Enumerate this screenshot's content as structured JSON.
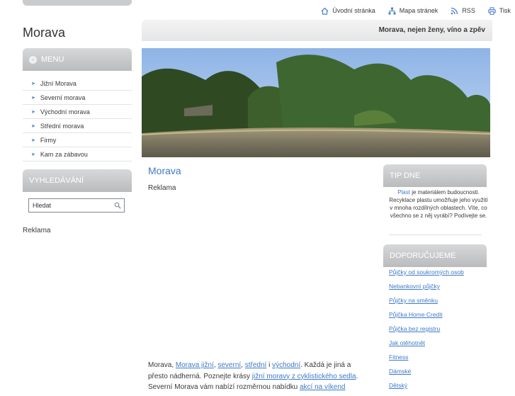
{
  "topnav": {
    "home": "Úvodní stránka",
    "sitemap": "Mapa stránek",
    "rss": "RSS",
    "print": "Tisk"
  },
  "site": {
    "title": "Morava",
    "slogan": "Morava, nejen ženy, víno a zpěv"
  },
  "menu": {
    "heading": "MENU",
    "items": [
      "Jižní Morava",
      "Severní morava",
      "Východní morava",
      "Střední morava",
      "Firmy",
      "Kam za zábavou"
    ]
  },
  "search": {
    "heading": "VYHLEDÁVÁNÍ",
    "value": "Hledat"
  },
  "left_ad": "Reklama",
  "main": {
    "title": "Morava",
    "ad": "Reklama",
    "p_1": "Morava, ",
    "link_south": "Morava jižní",
    "p_2": ", ",
    "link_north": "severní",
    "p_3": ", ",
    "link_central": "střední",
    "p_4": " i ",
    "link_east": "východní",
    "p_5": ". Každá je jiná a přesto nádherná. Poznejte krásy ",
    "link_cycling": "jižní moravy z cyklistického sedla",
    "p_6": ". Severní Morava vám nabízí rozměrnou nabídku ",
    "link_weekend": "akcí na víkend"
  },
  "tip": {
    "heading": "TIP DNE",
    "link": "Plast",
    "text": " je materiálem budoucnosti. Recyklace plastu umožňuje jeho využití v mnoha rozdílných oblastech. Víte, co všechno se z něj vyrábí? Podívejte se."
  },
  "recommend": {
    "heading": "DOPORUČUJEME",
    "items": [
      "Půjčky od soukromých osob",
      "Nebankovní půjčky",
      "Půjčky na směnku",
      "Půjčka Home Credit",
      "Půjčka bez registru",
      "Jak otěhotnět",
      "Fitness",
      "Dámské",
      "Dětský"
    ]
  },
  "colors": {
    "link": "#3f7ac7",
    "panel_header": "#b9bbbd",
    "text": "#3a3a3a"
  }
}
